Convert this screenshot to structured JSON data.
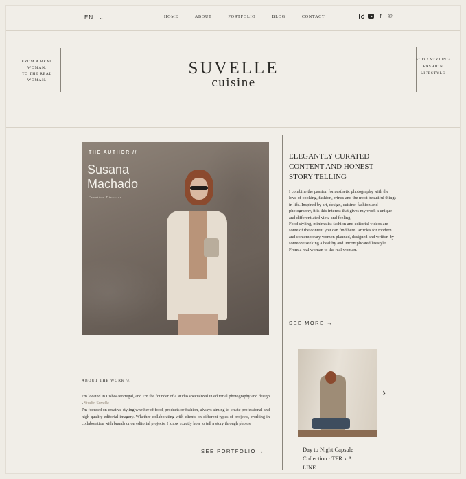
{
  "topbar": {
    "language": "EN",
    "nav": [
      "HOME",
      "ABOUT",
      "PORTFOLIO",
      "BLOG",
      "CONTACT"
    ],
    "social_icons": [
      "instagram-icon",
      "youtube-icon",
      "facebook-icon",
      "pinterest-icon"
    ]
  },
  "header": {
    "tagline_left": [
      "FROM A REAL",
      "WOMAN,",
      "TO THE REAL",
      "WOMAN."
    ],
    "logo_line1": "SUVELLE",
    "logo_line2": "cuisine",
    "tagline_right": [
      "FOOD STYLING",
      "FASHION",
      "LIFESTYLE"
    ]
  },
  "author": {
    "label": "THE AUTHOR //",
    "name_line1": "Susana",
    "name_line2": "Machado",
    "role": "Creative Director"
  },
  "intro": {
    "title_line1": "ELEGANTLY CURATED",
    "title_line2": "CONTENT AND HONEST",
    "title_line3": "STORY TELLING",
    "p1": "I combine the passion for aesthetic photography with the love of cooking, fashion, wines and the most beautiful things in life. Inspired by art, design, cuisine, fashion and photography, it is this interest that gives my work a unique and differentiated view and feeling.",
    "p2": "Food styling, minimalist fashion and editorial videos are some of the content you can find here. Articles for modern and contemporary women planned, designed and written by someone seeking a healthy and uncomplicated lifestyle.",
    "p3": "From a real woman to the real woman.",
    "see_more": "SEE MORE →"
  },
  "about_work": {
    "title": "ABOUT THE WORK \\\\",
    "text_a": "I'm located in Lisboa/Portugal, and I'm the founder of a studio specialized in editorial photography and design - ",
    "studio": "Studio Suvelle.",
    "text_b": "I'm focused on creative styling whether of food, products or fashion, always aiming to create professional and high quality editorial imagery. Whether collaborating with clients on different types of projects, working in collaboration with brands or on editorial projects, I know exactly how to tell a story through photos.",
    "see_portfolio": "SEE PORTFOLIO →"
  },
  "post": {
    "title_line1": "Day to Night Capsule",
    "title_line2": "Collection · TFR x A",
    "title_line3": "LINE",
    "next_arrow": "›"
  }
}
